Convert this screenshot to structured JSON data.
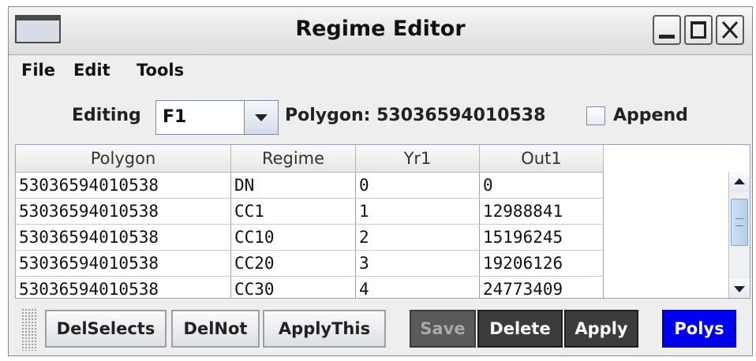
{
  "window": {
    "title": "Regime Editor",
    "controls": [
      "minimize-icon",
      "maximize-icon",
      "close-icon"
    ]
  },
  "menu": {
    "items": [
      "File",
      "Edit",
      "Tools"
    ]
  },
  "editor": {
    "editing_label": "Editing",
    "editing_value": "F1",
    "polygon_label": "Polygon: 53036594010538",
    "append_label": "Append",
    "append_checked": false
  },
  "table": {
    "columns": [
      "Polygon",
      "Regime",
      "Yr1",
      "Out1"
    ],
    "rows": [
      [
        "53036594010538",
        "DN",
        "0",
        "0"
      ],
      [
        "53036594010538",
        "CC1",
        "1",
        "12988841"
      ],
      [
        "53036594010538",
        "CC10",
        "2",
        "15196245"
      ],
      [
        "53036594010538",
        "CC20",
        "3",
        "19206126"
      ],
      [
        "53036594010538",
        "CC30",
        "4",
        "24773409"
      ]
    ]
  },
  "toolbar": {
    "delselects": "DelSelects",
    "delnot": "DelNot",
    "applythis": "ApplyThis",
    "save": "Save",
    "delete": "Delete",
    "apply": "Apply",
    "polys": "Polys"
  },
  "colors": {
    "polys_button": "#0000f0",
    "dark_button": "#3c3c3c"
  }
}
